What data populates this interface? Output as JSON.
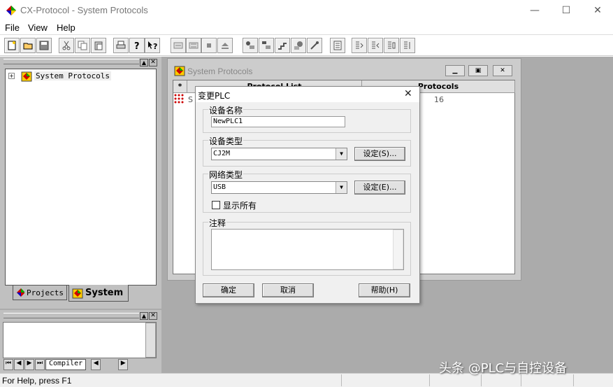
{
  "app": {
    "title": "CX-Protocol - System Protocols"
  },
  "window_controls": {
    "minimize": "—",
    "maximize": "☐",
    "close": "✕"
  },
  "menu": [
    "File",
    "View",
    "Help"
  ],
  "tree": {
    "root": "System Protocols"
  },
  "tabs": {
    "projects": "Projects",
    "system": "System"
  },
  "output_tabs": {
    "compiler": "Compiler"
  },
  "child_window": {
    "title": "System Protocols",
    "columns": [
      "*",
      "Protocol List",
      "Protocols"
    ],
    "row": {
      "name": "S",
      "protocols": "16"
    }
  },
  "dialog": {
    "title": "变更PLC",
    "device_name_label": "设备名称",
    "device_name_value": "NewPLC1",
    "device_type_label": "设备类型",
    "device_type_value": "CJ2M",
    "device_settings_button": "设定(S)...",
    "network_type_label": "网络类型",
    "network_type_value": "USB",
    "network_settings_button": "设定(E)...",
    "show_all_label": "显示所有",
    "comment_label": "注释",
    "ok_button": "确定",
    "cancel_button": "取消",
    "help_button": "帮助(H)"
  },
  "status": {
    "text": "For Help, press F1"
  },
  "watermark": "头条 @PLC与自控设备"
}
